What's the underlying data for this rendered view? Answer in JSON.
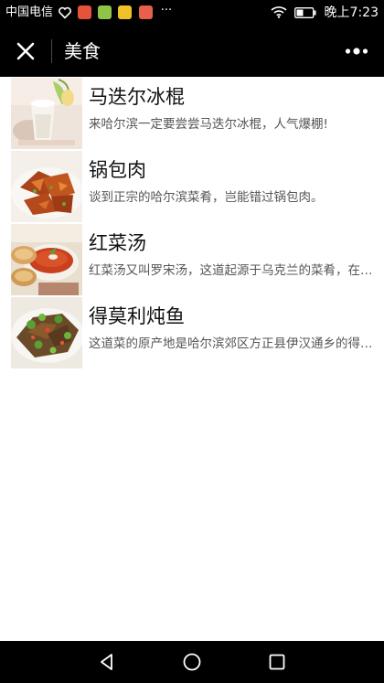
{
  "status_bar": {
    "carrier": "中国电信",
    "overflow": "···",
    "time": "晚上7:23",
    "icons": [
      "heart-notification-icon",
      "app-notification-icon",
      "app-notification-icon",
      "app-notification-icon",
      "app-notification-icon",
      "wifi-icon",
      "battery-icon"
    ]
  },
  "title_bar": {
    "title": "美食",
    "close_icon": "close-icon",
    "more_icon": "more-dots-icon"
  },
  "food_list": [
    {
      "title": "马迭尔冰棍",
      "desc": "来哈尔滨一定要尝尝马迭尔冰棍，人气爆棚!"
    },
    {
      "title": "锅包肉",
      "desc": "谈到正宗的哈尔滨菜肴，岂能错过锅包肉。"
    },
    {
      "title": "红菜汤",
      "desc": "红菜汤又叫罗宋汤，这道起源于乌克兰的菜肴，在哈尔滨已有百年历史"
    },
    {
      "title": "得莫利炖鱼",
      "desc": "这道菜的原产地是哈尔滨郊区方正县伊汉通乡的得莫利村"
    }
  ],
  "nav_bar": {
    "icons": [
      "back-triangle-icon",
      "home-circle-icon",
      "recent-square-icon"
    ]
  },
  "colors": {
    "bar_background": "#000000",
    "page_background": "#ffffff",
    "title_text": "#111111",
    "desc_text": "#555555"
  }
}
